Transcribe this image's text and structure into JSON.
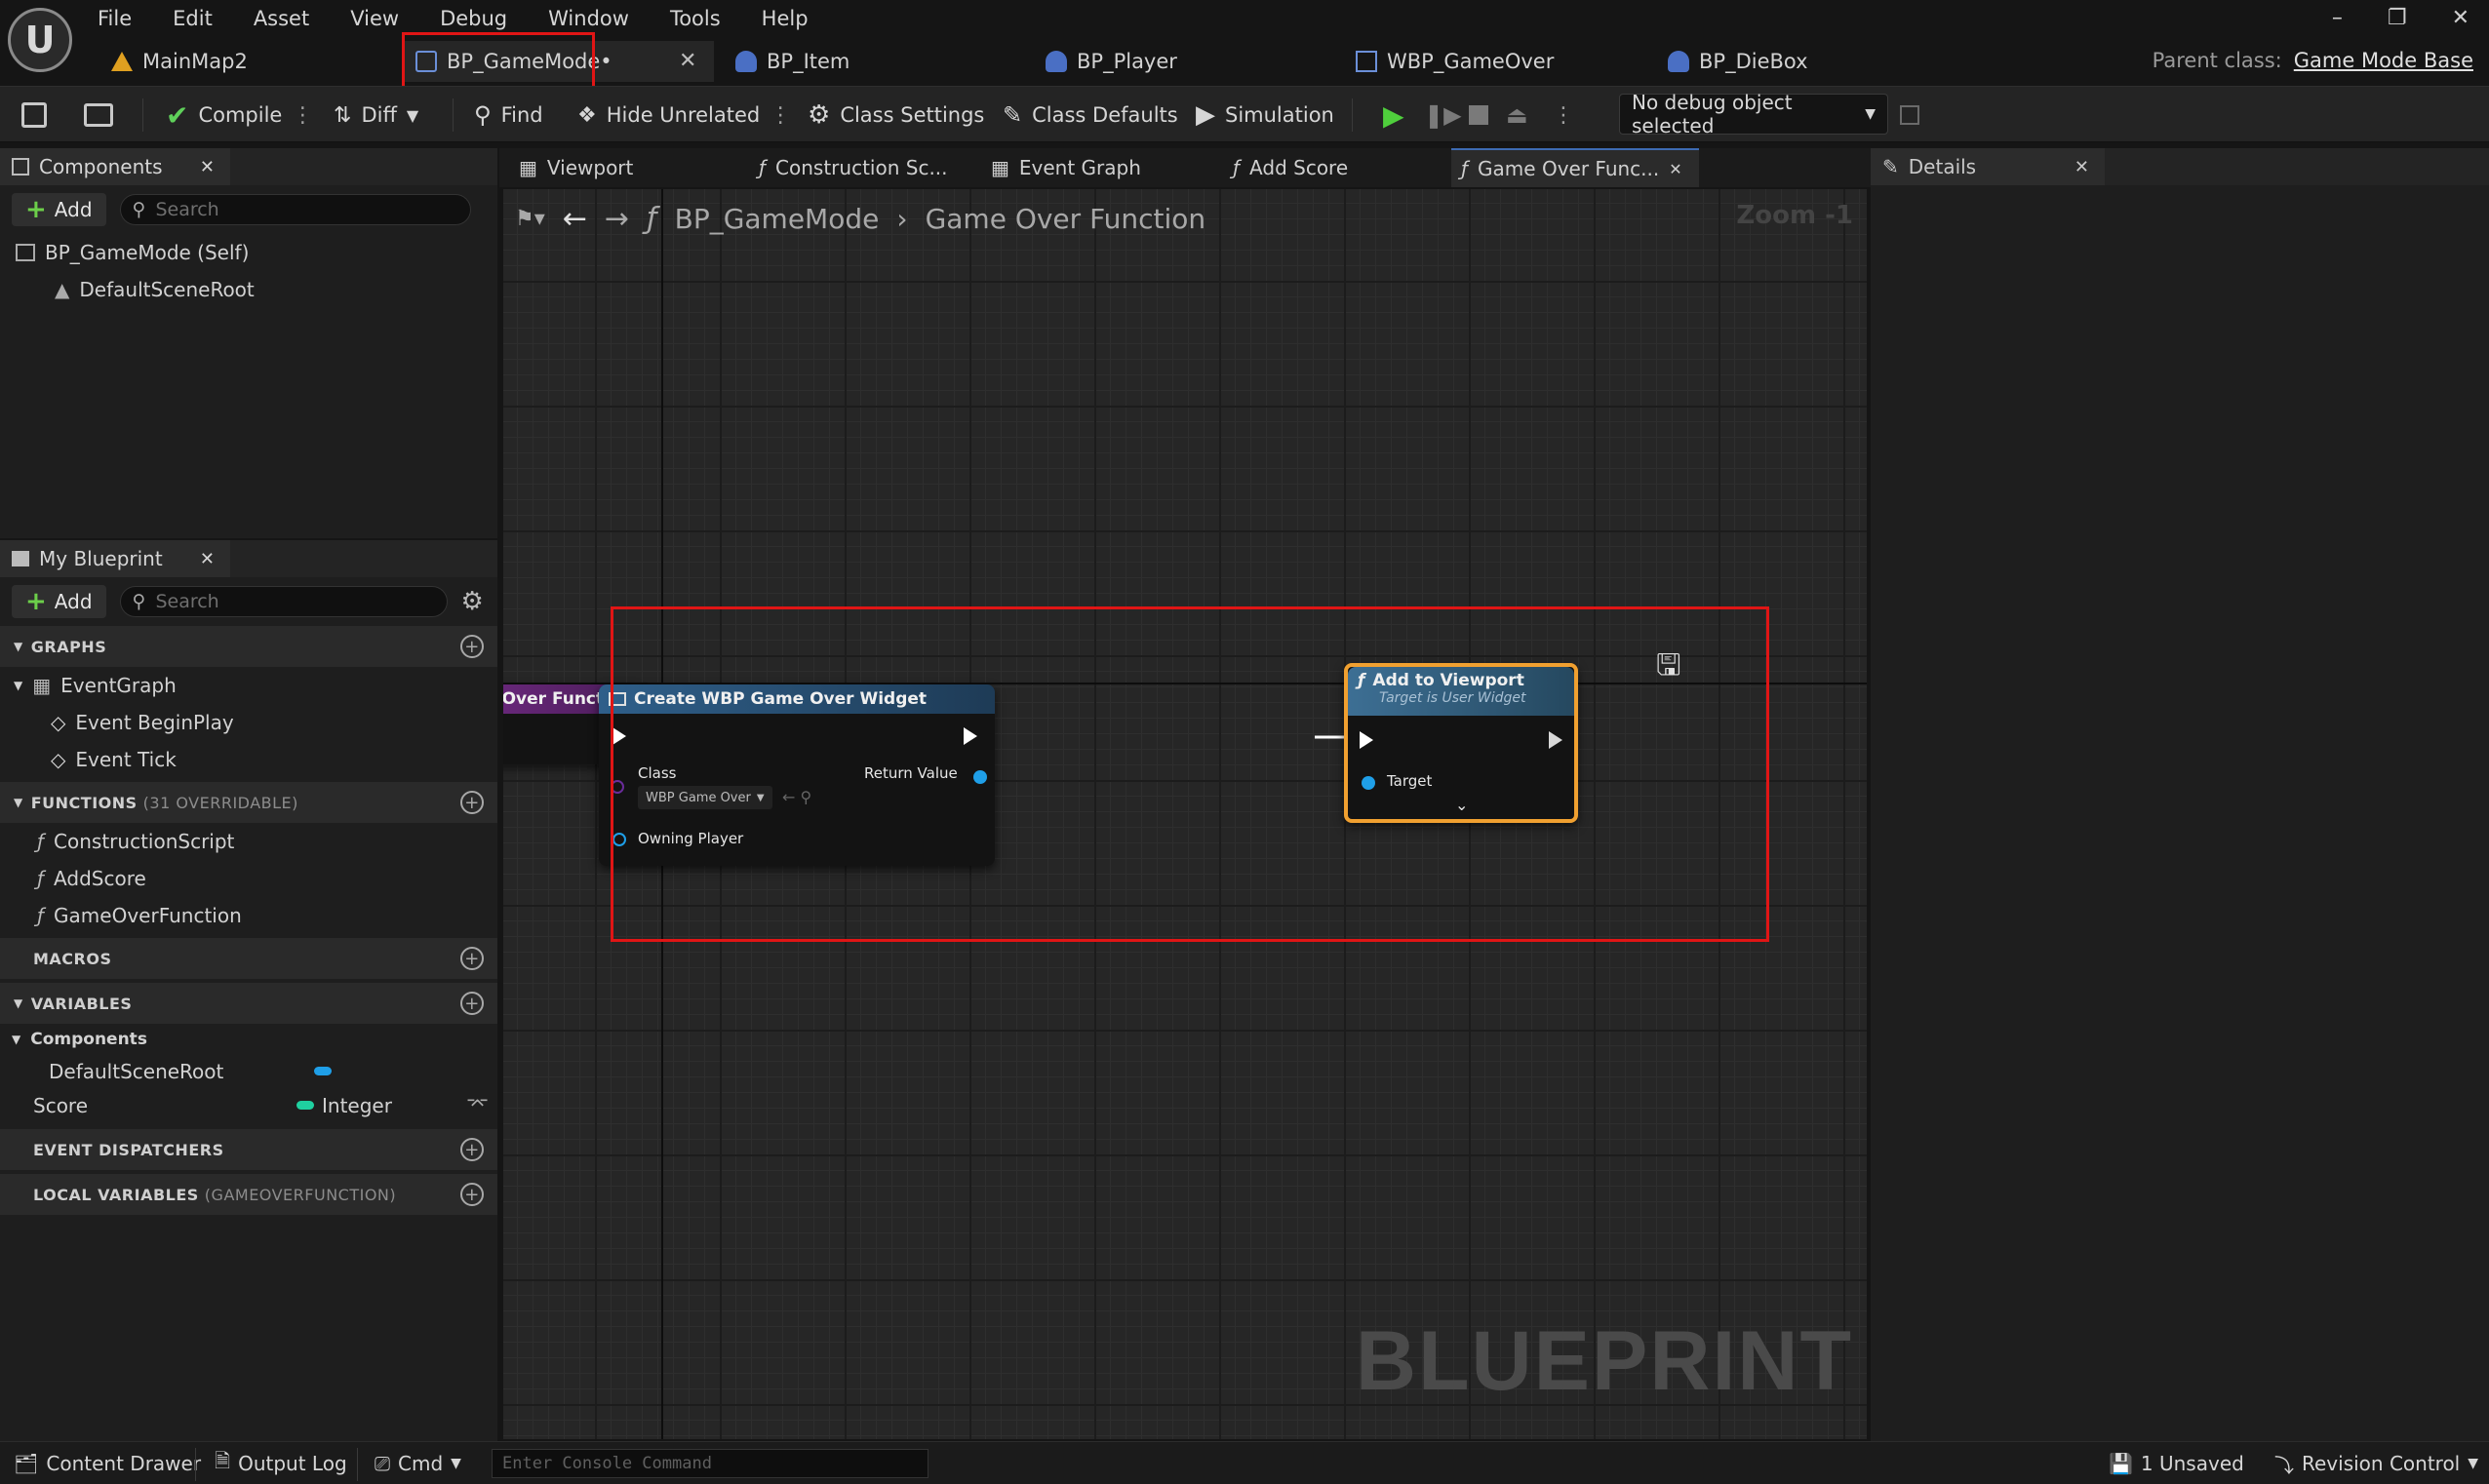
{
  "menu": [
    "File",
    "Edit",
    "Asset",
    "View",
    "Debug",
    "Window",
    "Tools",
    "Help"
  ],
  "doc_tabs": [
    {
      "label": "MainMap2",
      "icon": "level-icon"
    },
    {
      "label": "BP_GameMode•",
      "icon": "blueprint-icon",
      "active": true
    },
    {
      "label": "BP_Item",
      "icon": "actor-icon"
    },
    {
      "label": "BP_Player",
      "icon": "actor-icon"
    },
    {
      "label": "WBP_GameOver",
      "icon": "widget-icon"
    },
    {
      "label": "BP_DieBox",
      "icon": "actor-icon"
    }
  ],
  "parent_class": {
    "label": "Parent class:",
    "value": "Game Mode Base"
  },
  "toolbar": {
    "compile": "Compile",
    "diff": "Diff",
    "find": "Find",
    "hide_unrelated": "Hide Unrelated",
    "class_settings": "Class Settings",
    "class_defaults": "Class Defaults",
    "simulation": "Simulation",
    "debug_object": "No debug object selected"
  },
  "components_panel": {
    "title": "Components",
    "add": "Add",
    "search_placeholder": "Search",
    "items": [
      "BP_GameMode (Self)",
      "DefaultSceneRoot"
    ]
  },
  "my_blueprint": {
    "title": "My Blueprint",
    "add": "Add",
    "search_placeholder": "Search",
    "graphs_header": "GRAPHS",
    "graphs": [
      "EventGraph",
      "Event BeginPlay",
      "Event Tick"
    ],
    "functions_header": "FUNCTIONS",
    "functions_sub": "(31 OVERRIDABLE)",
    "functions": [
      "ConstructionScript",
      "AddScore",
      "GameOverFunction"
    ],
    "macros_header": "MACROS",
    "variables_header": "VARIABLES",
    "var_group": "Components",
    "variables": [
      {
        "name": "DefaultSceneRoot",
        "type": ""
      },
      {
        "name": "Score",
        "type": "Integer"
      }
    ],
    "dispatchers_header": "EVENT DISPATCHERS",
    "locals_header": "LOCAL VARIABLES",
    "locals_sub": "(GAMEOVERFUNCTION)"
  },
  "graph_tabs": [
    "Viewport",
    "Construction Sc...",
    "Event Graph",
    "Add Score",
    "Game Over Func..."
  ],
  "breadcrumb": {
    "root": "BP_GameMode",
    "current": "Game Over Function"
  },
  "zoom": "Zoom -1",
  "watermark": "BLUEPRINT",
  "nodes": {
    "entry": {
      "title": "Game Over Function"
    },
    "create_widget": {
      "title": "Create WBP Game Over Widget",
      "class_label": "Class",
      "class_value": "WBP Game Over",
      "return_label": "Return Value",
      "owner_label": "Owning Player"
    },
    "add_viewport": {
      "title": "Add to Viewport",
      "subtitle": "Target is User Widget",
      "target_label": "Target"
    }
  },
  "details_panel": {
    "title": "Details"
  },
  "statusbar": {
    "content_drawer": "Content Drawer",
    "output_log": "Output Log",
    "cmd": "Cmd",
    "console_placeholder": "Enter Console Command",
    "unsaved": "1 Unsaved",
    "revision_control": "Revision Control"
  },
  "colors": {
    "function_purple": "#7a2e8e",
    "widget_blue": "#2f5f8a",
    "highlight_red": "#e01515",
    "selected_orange": "#f0a030"
  }
}
